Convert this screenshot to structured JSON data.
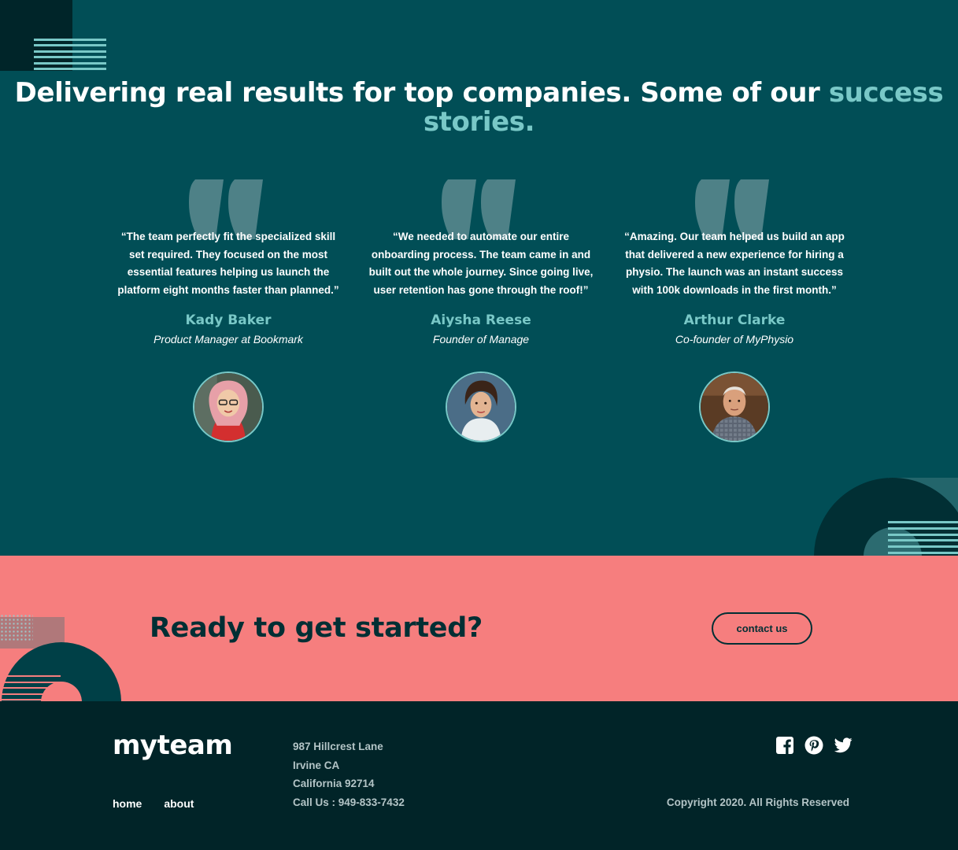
{
  "testimonials": {
    "headline_main": "Delivering real results for top companies. Some of our ",
    "headline_accent": "success stories.",
    "items": [
      {
        "quote": "“The team perfectly fit the specialized skill set required. They focused on the most essential features helping us launch the platform eight months faster than planned.”",
        "name": "Kady Baker",
        "role": "Product Manager at Bookmark"
      },
      {
        "quote": "“We needed to automate our entire onboarding process. The team came in and built out the whole journey. Since going live, user retention has gone through the roof!”",
        "name": "Aiysha Reese",
        "role": "Founder of Manage"
      },
      {
        "quote": "“Amazing. Our team helped us build an app that delivered a new experience for hiring a physio. The launch was an instant success with 100k downloads in the first month.”",
        "name": "Arthur Clarke",
        "role": "Co-founder of MyPhysio"
      }
    ]
  },
  "cta": {
    "title": "Ready to get started?",
    "button_label": "contact us"
  },
  "footer": {
    "logo": "myteam",
    "nav": {
      "home": "home",
      "about": "about"
    },
    "address": {
      "line1": "987 Hillcrest Lane",
      "line2": "Irvine CA",
      "line3": "California 92714",
      "phone": "Call Us : 949-833-7432"
    },
    "socials": [
      "facebook-icon",
      "pinterest-icon",
      "twitter-icon"
    ],
    "copyright": "Copyright 2020. All Rights Reserved"
  },
  "colors": {
    "dark_teal": "#014e56",
    "deep_teal": "#002529",
    "light_teal": "#79c8c7",
    "coral": "#f67e7e",
    "footer_bg": "#012428"
  }
}
